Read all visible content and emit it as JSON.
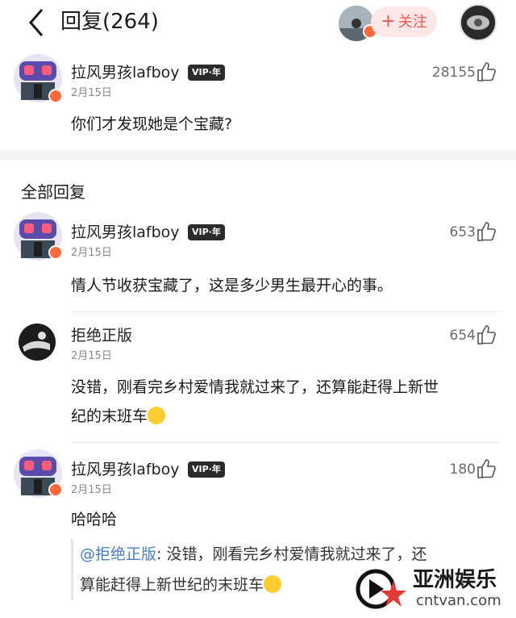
{
  "header": {
    "title": "回复(264)",
    "follow_label": "关注",
    "follow_plus": "+"
  },
  "top_comment": {
    "username": "拉风男孩lafboy",
    "vip": "VIP·年",
    "date": "2月15日",
    "likes": "28155",
    "text": "你们才发现她是个宝藏?"
  },
  "section_title": "全部回复",
  "replies": [
    {
      "username": "拉风男孩lafboy",
      "vip": "VIP·年",
      "date": "2月15日",
      "likes": "653",
      "text": "情人节收获宝藏了，这是多少男生最开心的事。"
    },
    {
      "username": "拒绝正版",
      "date": "2月15日",
      "likes": "654",
      "text_line1": "没错，刚看完乡村爱情我就过来了，还算能赶得上新世",
      "text_line2": "纪的末班车"
    },
    {
      "username": "拉风男孩lafboy",
      "vip": "VIP·年",
      "date": "2月15日",
      "likes": "180",
      "text": "哈哈哈",
      "quote_mention": "@拒绝正版",
      "quote_line1": ": 没错，刚看完乡村爱情我就过来了，还",
      "quote_line2": "算能赶得上新世纪的末班车"
    }
  ],
  "watermark": {
    "name": "亚洲娱乐",
    "domain": "cntvan.com"
  },
  "colors": {
    "accent_red": "#f05656",
    "mention_blue": "#4a7fbf",
    "meta_gray": "#8a8a8a"
  }
}
